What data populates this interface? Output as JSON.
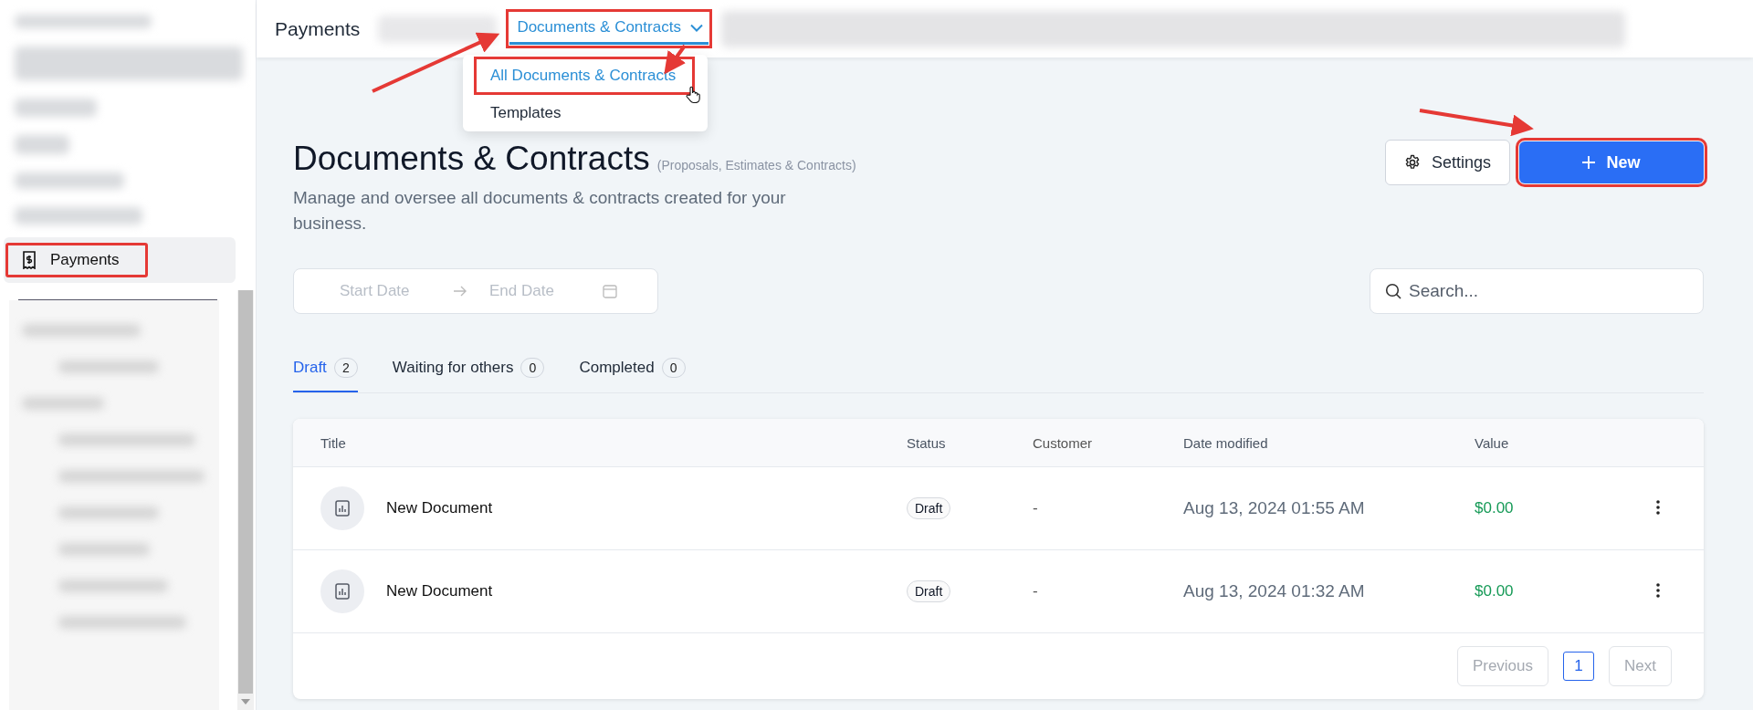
{
  "sidebar": {
    "items": [
      {
        "label": "Payments",
        "selected": true,
        "highlighted": true
      }
    ]
  },
  "topbar": {
    "title": "Payments",
    "nav_dropdown": {
      "label": "Documents & Contracts",
      "expanded": true,
      "highlighted": true
    }
  },
  "dropdown_menu": {
    "items": [
      {
        "label": "All Documents & Contracts",
        "selected": true,
        "highlighted": true
      },
      {
        "label": "Templates",
        "selected": false,
        "highlighted": false
      }
    ]
  },
  "page_header": {
    "title": "Documents & Contracts",
    "subtitle": "(Proposals, Estimates & Contracts)",
    "description": "Manage and oversee all documents & contracts created for your business."
  },
  "buttons": [
    {
      "kind": "settings",
      "label": "Settings",
      "highlighted": false
    },
    {
      "kind": "new",
      "label": "New",
      "highlighted": true
    }
  ],
  "date_range": {
    "start_placeholder": "Start Date",
    "end_placeholder": "End Date"
  },
  "search": {
    "placeholder": "Search..."
  },
  "tabs": [
    {
      "label": "Draft",
      "count": "2",
      "selected": true
    },
    {
      "label": "Waiting for others",
      "count": "0",
      "selected": false
    },
    {
      "label": "Completed",
      "count": "0",
      "selected": false
    }
  ],
  "table": {
    "columns": [
      "Title",
      "Status",
      "Customer",
      "Date modified",
      "Value"
    ],
    "rows": [
      {
        "title": "New Document",
        "status": "Draft",
        "customer": "-",
        "date_modified": "Aug 13, 2024 01:55 AM",
        "value": "$0.00"
      },
      {
        "title": "New Document",
        "status": "Draft",
        "customer": "-",
        "date_modified": "Aug 13, 2024 01:32 AM",
        "value": "$0.00"
      }
    ]
  },
  "pagination": {
    "previous": {
      "label": "Previous",
      "disabled": true
    },
    "pages": [
      {
        "label": "1",
        "selected": true
      }
    ],
    "next": {
      "label": "Next",
      "disabled": true
    }
  }
}
